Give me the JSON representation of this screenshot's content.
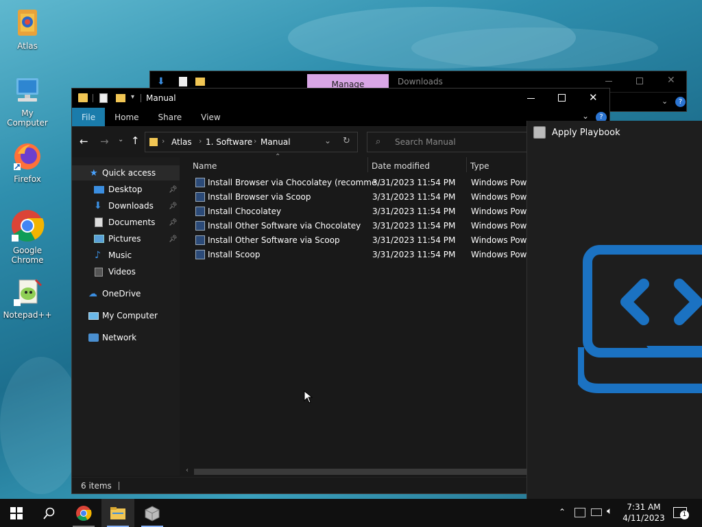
{
  "desktop": {
    "icons": [
      {
        "label": "Atlas"
      },
      {
        "label": "My Computer"
      },
      {
        "label": "Firefox"
      },
      {
        "label": "Google Chrome"
      },
      {
        "label": "Notepad++"
      }
    ]
  },
  "back_window": {
    "manage_tab": "Manage",
    "title": "Downloads"
  },
  "explorer": {
    "title": "Manual",
    "ribbon_tabs": [
      "File",
      "Home",
      "Share",
      "View"
    ],
    "breadcrumb": [
      "Atlas",
      "1. Software",
      "Manual"
    ],
    "search_placeholder": "Search Manual",
    "nav": {
      "quick_access": "Quick access",
      "pinned": [
        "Desktop",
        "Downloads",
        "Documents",
        "Pictures"
      ],
      "unpinned": [
        "Music",
        "Videos"
      ],
      "onedrive": "OneDrive",
      "my_computer": "My Computer",
      "network": "Network"
    },
    "columns": [
      "Name",
      "Date modified",
      "Type"
    ],
    "files": [
      {
        "name": "Install Browser via Chocolatey (recomme...",
        "date": "3/31/2023 11:54 PM",
        "type": "Windows Powe"
      },
      {
        "name": "Install Browser via Scoop",
        "date": "3/31/2023 11:54 PM",
        "type": "Windows Powe"
      },
      {
        "name": "Install Chocolatey",
        "date": "3/31/2023 11:54 PM",
        "type": "Windows Powe"
      },
      {
        "name": "Install Other Software via Chocolatey",
        "date": "3/31/2023 11:54 PM",
        "type": "Windows Powe"
      },
      {
        "name": "Install Other Software via Scoop",
        "date": "3/31/2023 11:54 PM",
        "type": "Windows Powe"
      },
      {
        "name": "Install Scoop",
        "date": "3/31/2023 11:54 PM",
        "type": "Windows Powe"
      }
    ],
    "status": "6 items"
  },
  "playbook": {
    "title": "Apply Playbook"
  },
  "taskbar": {
    "time": "7:31 AM",
    "date": "4/11/2023",
    "notification_count": "1"
  },
  "colors": {
    "accent": "#1a7cab",
    "playbook_logo": "#1b72c2",
    "selection": "#2a2a2a"
  }
}
